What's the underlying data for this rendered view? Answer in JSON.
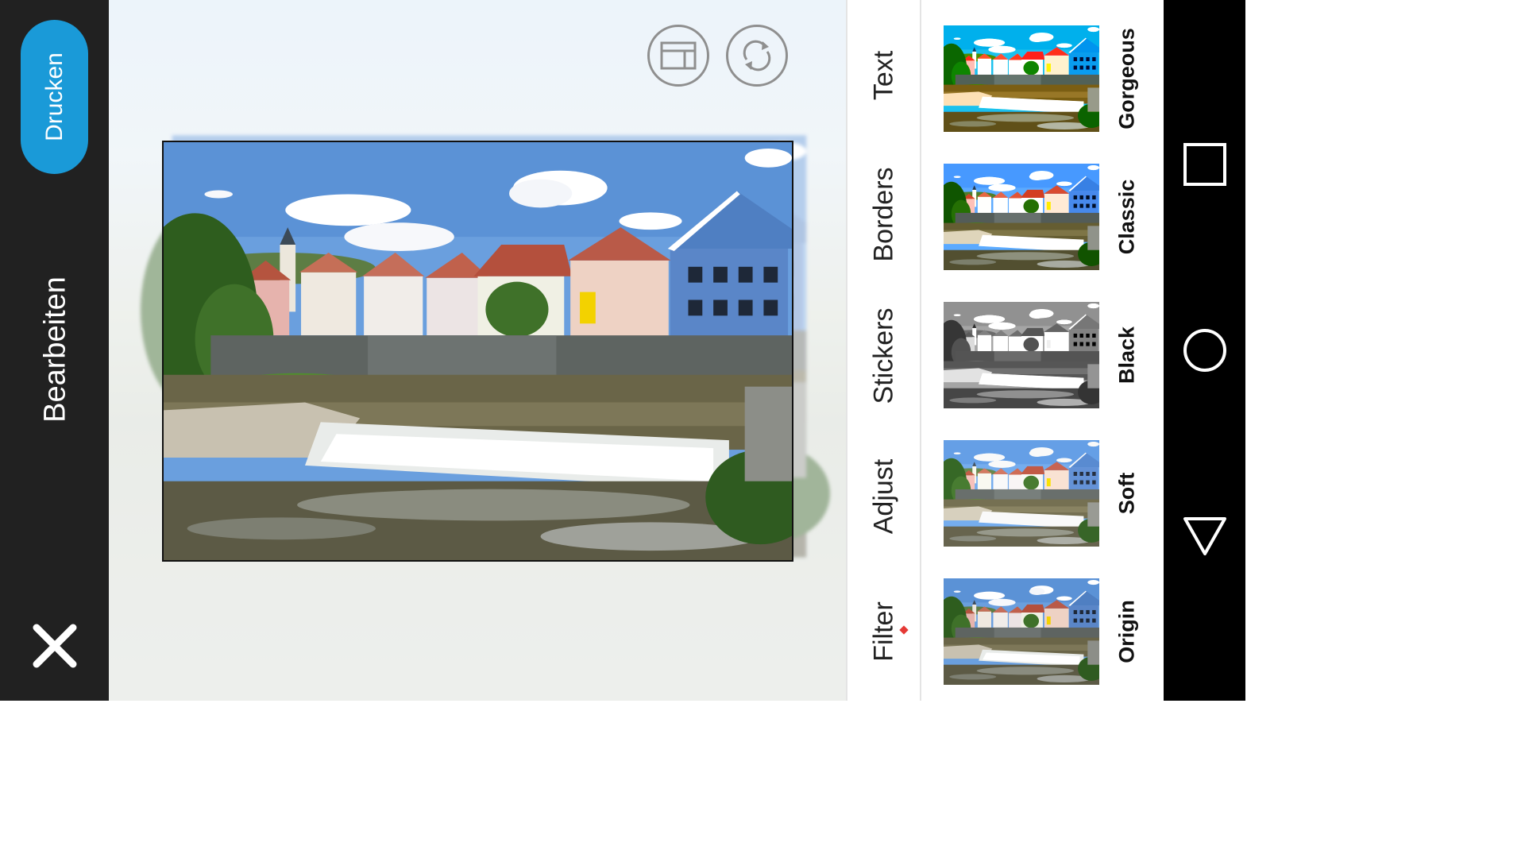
{
  "sidebar": {
    "print_label": "Drucken",
    "title": "Bearbeiten",
    "close_icon": "close-icon"
  },
  "toolbar": {
    "layout_icon": "layout-icon",
    "rotate_icon": "rotate-icon"
  },
  "tabs": [
    {
      "label": "Text"
    },
    {
      "label": "Borders"
    },
    {
      "label": "Stickers"
    },
    {
      "label": "Adjust"
    },
    {
      "label": "Filter",
      "active": true
    }
  ],
  "filters": [
    {
      "label": "Gorgeous"
    },
    {
      "label": "Classic"
    },
    {
      "label": "Black"
    },
    {
      "label": "Soft"
    },
    {
      "label": "Origin"
    }
  ],
  "nav": {
    "recents_icon": "square-recents-icon",
    "home_icon": "circle-home-icon",
    "back_icon": "triangle-back-icon"
  },
  "colors": {
    "accent": "#1a9ad8",
    "sidebar": "#212121",
    "active_indicator": "#e53935"
  }
}
